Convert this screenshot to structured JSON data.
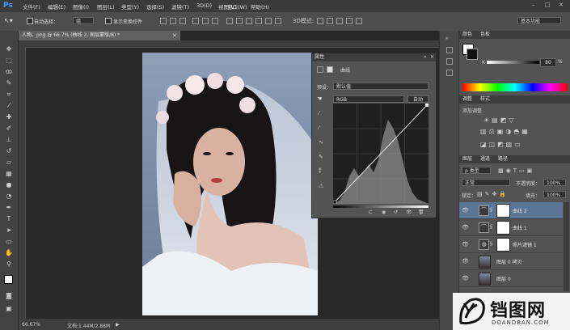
{
  "app": {
    "logo": "Ps",
    "menus": [
      "文件(F)",
      "编辑(E)",
      "图像(I)",
      "图层(L)",
      "类型(Y)",
      "选择(S)",
      "滤镜(T)",
      "3D(D)",
      "视图(V)",
      "窗口(W)",
      "帮助(H)"
    ],
    "window_controls": [
      "–",
      "□",
      "✕"
    ]
  },
  "options_bar": {
    "auto_select_label": "自动选择：",
    "auto_select_value": "组",
    "show_transform_label": "显示变换控件",
    "workspace_value": "基本功能"
  },
  "document": {
    "tab_title": "人物。png @ 66.7% (曲线 2, 图层蒙版/8) *",
    "zoom": "66.67%",
    "doc_size": "文档:1.44M/2.88M"
  },
  "properties": {
    "title": "属性",
    "preset_label": "预设：",
    "preset_value": "默认值",
    "channel_value": "RGB",
    "auto_button": "自动"
  },
  "color_panel": {
    "tabs": [
      "颜色",
      "色板"
    ],
    "k_label": "K",
    "k_value": "80",
    "k_percent": "%"
  },
  "adjustments_panel": {
    "tabs": [
      "调整",
      "样式"
    ],
    "add_label": "添加调整"
  },
  "layers_panel": {
    "tabs": [
      "图层",
      "通道",
      "路径"
    ],
    "kind_label": "ρ 类型",
    "blend_mode": "正常",
    "opacity_label": "不透明度：",
    "opacity_value": "100%",
    "lock_label": "锁定：",
    "fill_label": "填充：",
    "fill_value": "100%",
    "layers": [
      {
        "name": "曲线 2",
        "icon": "curves-icon",
        "selected": true
      },
      {
        "name": "曲线 1",
        "icon": "curves-icon",
        "selected": false
      },
      {
        "name": "照片滤镜 1",
        "icon": "photo-filter-icon",
        "selected": false
      },
      {
        "name": "图层 0 拷贝",
        "icon": "image-thumb",
        "selected": false
      },
      {
        "name": "图层 0",
        "icon": "image-thumb",
        "selected": false
      }
    ]
  },
  "watermark": {
    "brand": "铛图网",
    "url": "DOANDBAN.COM"
  },
  "colors": {
    "menubar_bg": "#3a3a3a",
    "panel_bg": "#535353",
    "canvas_bg": "#282828",
    "selected_layer": "#5b7596",
    "ps_blue": "#3e9bff"
  }
}
